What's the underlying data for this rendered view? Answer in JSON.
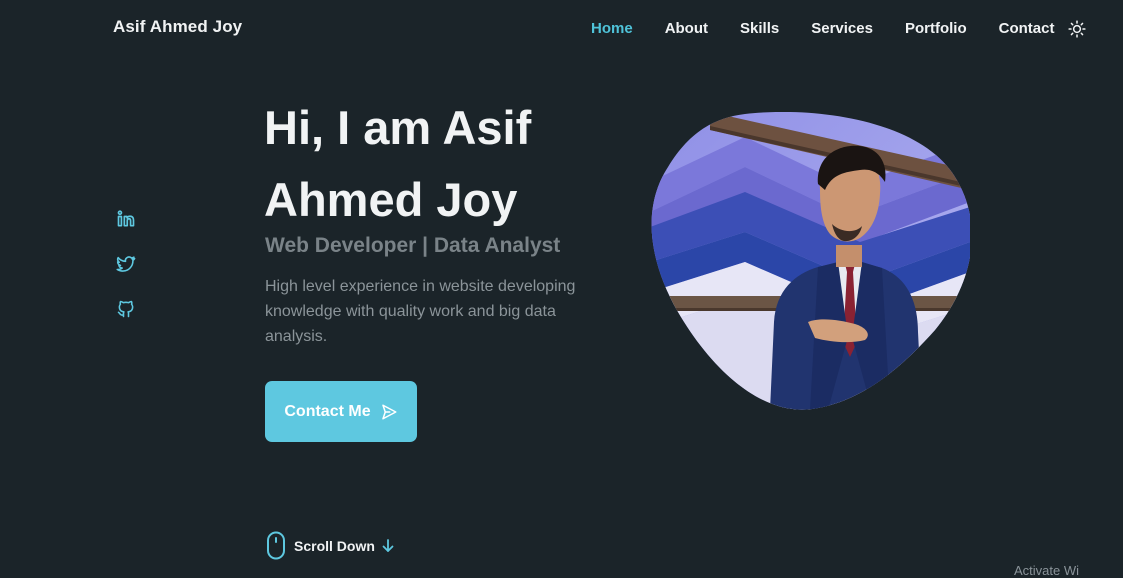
{
  "header": {
    "brand": "Asif Ahmed Joy",
    "nav": [
      {
        "label": "Home",
        "active": true
      },
      {
        "label": "About"
      },
      {
        "label": "Skills"
      },
      {
        "label": "Services"
      },
      {
        "label": "Portfolio"
      },
      {
        "label": "Contact"
      }
    ],
    "theme_icon": "sun-icon"
  },
  "social": [
    "linkedin-icon",
    "twitter-icon",
    "github-icon"
  ],
  "hero": {
    "title_line1": "Hi, I am Asif",
    "title_line2": "Ahmed Joy",
    "subtitle": "Web Developer | Data Analyst",
    "description": "High level experience in website developing knowledge with quality work and big data analysis.",
    "cta_label": "Contact Me",
    "cta_icon": "send-icon"
  },
  "scroll": {
    "label": "Scroll Down",
    "icons": [
      "mouse-icon",
      "arrow-down-icon"
    ]
  },
  "colors": {
    "background": "#1b2429",
    "accent": "#5ec8e0",
    "nav_active": "#4fc3d9",
    "muted_text": "#7a8388"
  },
  "watermark": "Activate Wi"
}
